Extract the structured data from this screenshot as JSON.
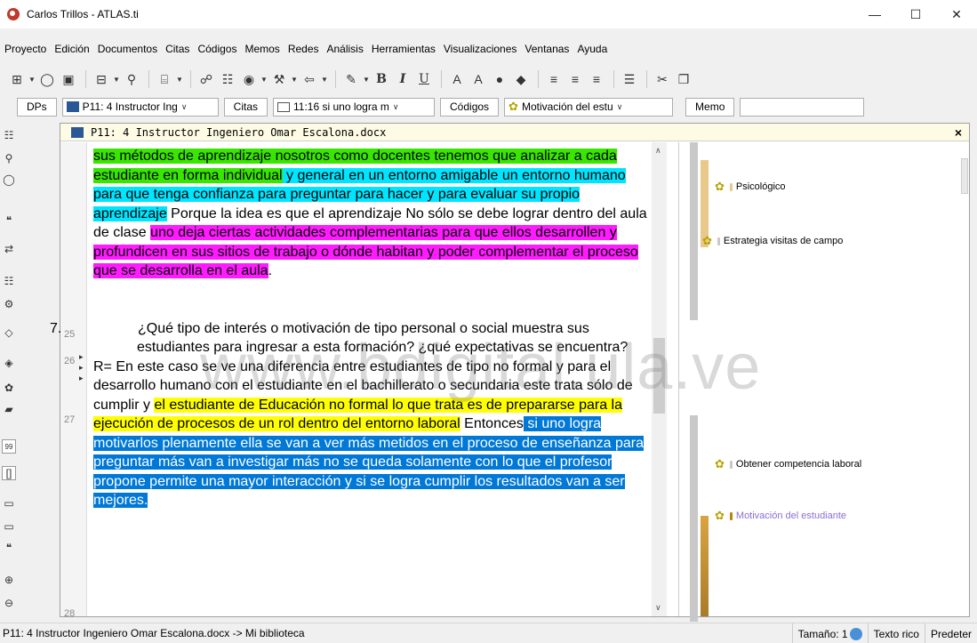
{
  "window": {
    "title": "Carlos Trillos - ATLAS.ti",
    "controls": [
      "—",
      "☐",
      "✕"
    ]
  },
  "menu": [
    "Proyecto",
    "Edición",
    "Documentos",
    "Citas",
    "Códigos",
    "Memos",
    "Redes",
    "Análisis",
    "Herramientas",
    "Visualizaciones",
    "Ventanas",
    "Ayuda"
  ],
  "navbar": {
    "dps": "DPs",
    "doc_select": "P11: 4 Instructor Ing",
    "citas": "Citas",
    "quote_select": "11:16 si uno logra m",
    "codigos": "Códigos",
    "code_select": "Motivación del estu",
    "memo": "Memo"
  },
  "panel": {
    "title": "P11: 4 Instructor Ingeniero Omar Escalona.docx",
    "close": "×"
  },
  "lines": [
    "25",
    "26",
    "27",
    "28"
  ],
  "text": {
    "p1_a": "sus métodos de aprendizaje nosotros como docentes tenemos que analizar a cada estudiante en forma individual",
    "p1_b": " y general en un entorno amigable un entorno humano para que tenga confianza para preguntar para hacer y para evaluar su propio aprendizaje",
    "p1_c": " Porque la idea es que el aprendizaje No sólo se debe lograr dentro del aula de clase ",
    "p1_d": "uno deja ciertas actividades complementarias para que ellos desarrollen y profundicen en sus sitios de trabajo o dónde habitan y poder complementar el proceso que se desarrolla en el aula",
    "p1_e": ".",
    "q_num": "7.",
    "q_text": "¿Qué tipo de interés o motivación de tipo personal o social muestra sus estudiantes para ingresar a esta formación? ¿qué expectativas se encuentra?",
    "r_a": "R= En este caso se ve una diferencia entre estudiantes de tipo no formal y para el desarrollo humano con el estudiante en el bachillerato o secundaria este trata sólo de cumplir y ",
    "r_b": "el estudiante de Educación no formal lo que trata es de prepararse para la ejecución de procesos de un rol dentro del entorno laboral",
    "r_c": " Entonces",
    "r_d": " si uno logra motivarlos plenamente ella se van a ver más metidos en el proceso de enseñanza para preguntar más van a investigar más no se queda solamente con lo que el profesor propone permite una mayor interacción y si se logra cumplir los resultados van a ser mejores."
  },
  "codes": [
    {
      "name": "Psicológico",
      "color": "#e8c98a",
      "text_color": "#000000"
    },
    {
      "name": "Estrategia visitas de campo",
      "color": "#c8c8c8",
      "text_color": "#000000"
    },
    {
      "name": "Obtener competencia laboral",
      "color": "#c8c8c8",
      "text_color": "#000000"
    },
    {
      "name": "Motivación del estudiante",
      "color": "#b8860b",
      "text_color": "#8a6fd6"
    }
  ],
  "watermark": "www.bdigital.ula.ve",
  "status": {
    "left": "P11: 4 Instructor Ingeniero Omar Escalona.docx ->  Mi biblioteca",
    "size": "Tamaño: 1",
    "texto": "Texto rico",
    "predet": "Predeter"
  }
}
